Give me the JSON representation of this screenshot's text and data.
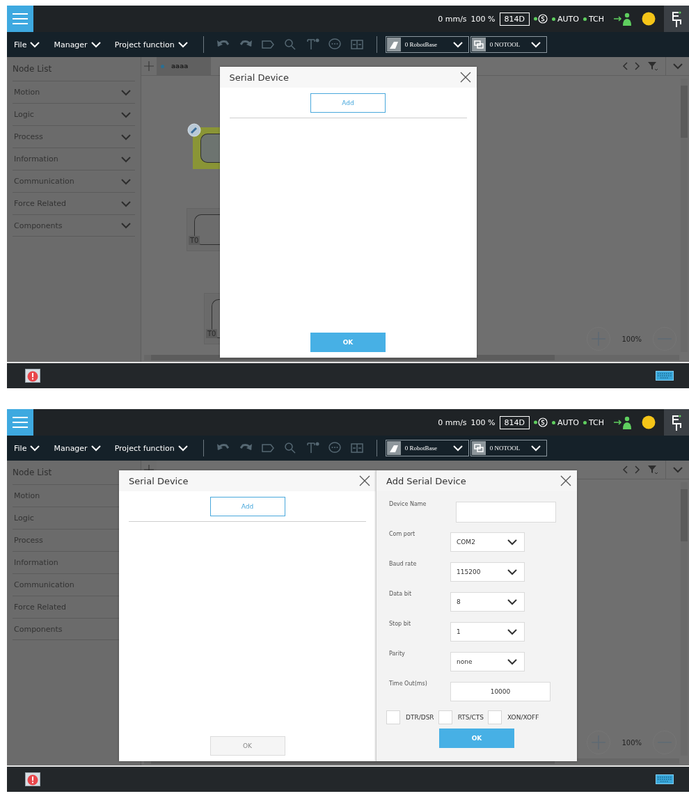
{
  "screens": [
    {
      "top_bar": {
        "speed": "0 mm/s",
        "percent": "100 %",
        "code": "814D",
        "mode": "AUTO",
        "tcp": "TCH"
      },
      "menus": [
        {
          "label": "File"
        },
        {
          "label": "Manager"
        },
        {
          "label": "Project function"
        }
      ],
      "selectors": [
        {
          "value": "0 RobotBase"
        },
        {
          "value": "0 NOTOOL"
        }
      ],
      "node_list": {
        "title": "Node List",
        "items": [
          {
            "label": "Motion"
          },
          {
            "label": "Logic"
          },
          {
            "label": "Process"
          },
          {
            "label": "Information"
          },
          {
            "label": "Communication"
          },
          {
            "label": "Force Related"
          },
          {
            "label": "Components"
          }
        ]
      },
      "tab": "aaaa",
      "nodes": [
        {
          "selected": true
        },
        {
          "selected": false,
          "label": "T0"
        },
        {
          "selected": false,
          "label": "T0"
        }
      ],
      "zoom": "100%",
      "dialogs": [
        {
          "kind": "list",
          "title": "Serial Device",
          "add": "Add",
          "ok": {
            "label": "OK",
            "disabled": false
          }
        }
      ]
    },
    {
      "top_bar": {
        "speed": "0 mm/s",
        "percent": "100 %",
        "code": "814D",
        "mode": "AUTO",
        "tcp": "TCH"
      },
      "menus": [
        {
          "label": "File"
        },
        {
          "label": "Manager"
        },
        {
          "label": "Project function"
        }
      ],
      "selectors": [
        {
          "value": "0 RobotBase"
        },
        {
          "value": "0 NOTOOL"
        }
      ],
      "node_list": {
        "title": "Node List",
        "items": [
          {
            "label": "Motion"
          },
          {
            "label": "Logic"
          },
          {
            "label": "Process"
          },
          {
            "label": "Information"
          },
          {
            "label": "Communication"
          },
          {
            "label": "Force Related"
          },
          {
            "label": "Components"
          }
        ]
      },
      "zoom": "100%",
      "dialogs": [
        {
          "kind": "list",
          "title": "Serial Device",
          "add": "Add",
          "ok": {
            "label": "OK",
            "disabled": true
          }
        },
        {
          "kind": "form",
          "title": "Add Serial Device",
          "fields": [
            {
              "kind": "text",
              "label": "Device Name"
            },
            {
              "kind": "select",
              "label": "Com port",
              "value": "COM2"
            },
            {
              "kind": "select",
              "label": "Baud rate",
              "value": "115200"
            },
            {
              "kind": "select",
              "label": "Data bit",
              "value": "8"
            },
            {
              "kind": "select",
              "label": "Stop bit",
              "value": "1"
            },
            {
              "kind": "select",
              "label": "Parity",
              "value": "none"
            },
            {
              "kind": "number",
              "label": "Time Out(ms)",
              "value": "10000"
            }
          ],
          "options": [
            {
              "label": "DTR/DSR",
              "checked": false
            },
            {
              "label": "RTS/CTS",
              "checked": false
            },
            {
              "label": "XON/XOFF",
              "checked": false
            }
          ],
          "ok": {
            "label": "OK",
            "disabled": false
          }
        }
      ]
    }
  ]
}
